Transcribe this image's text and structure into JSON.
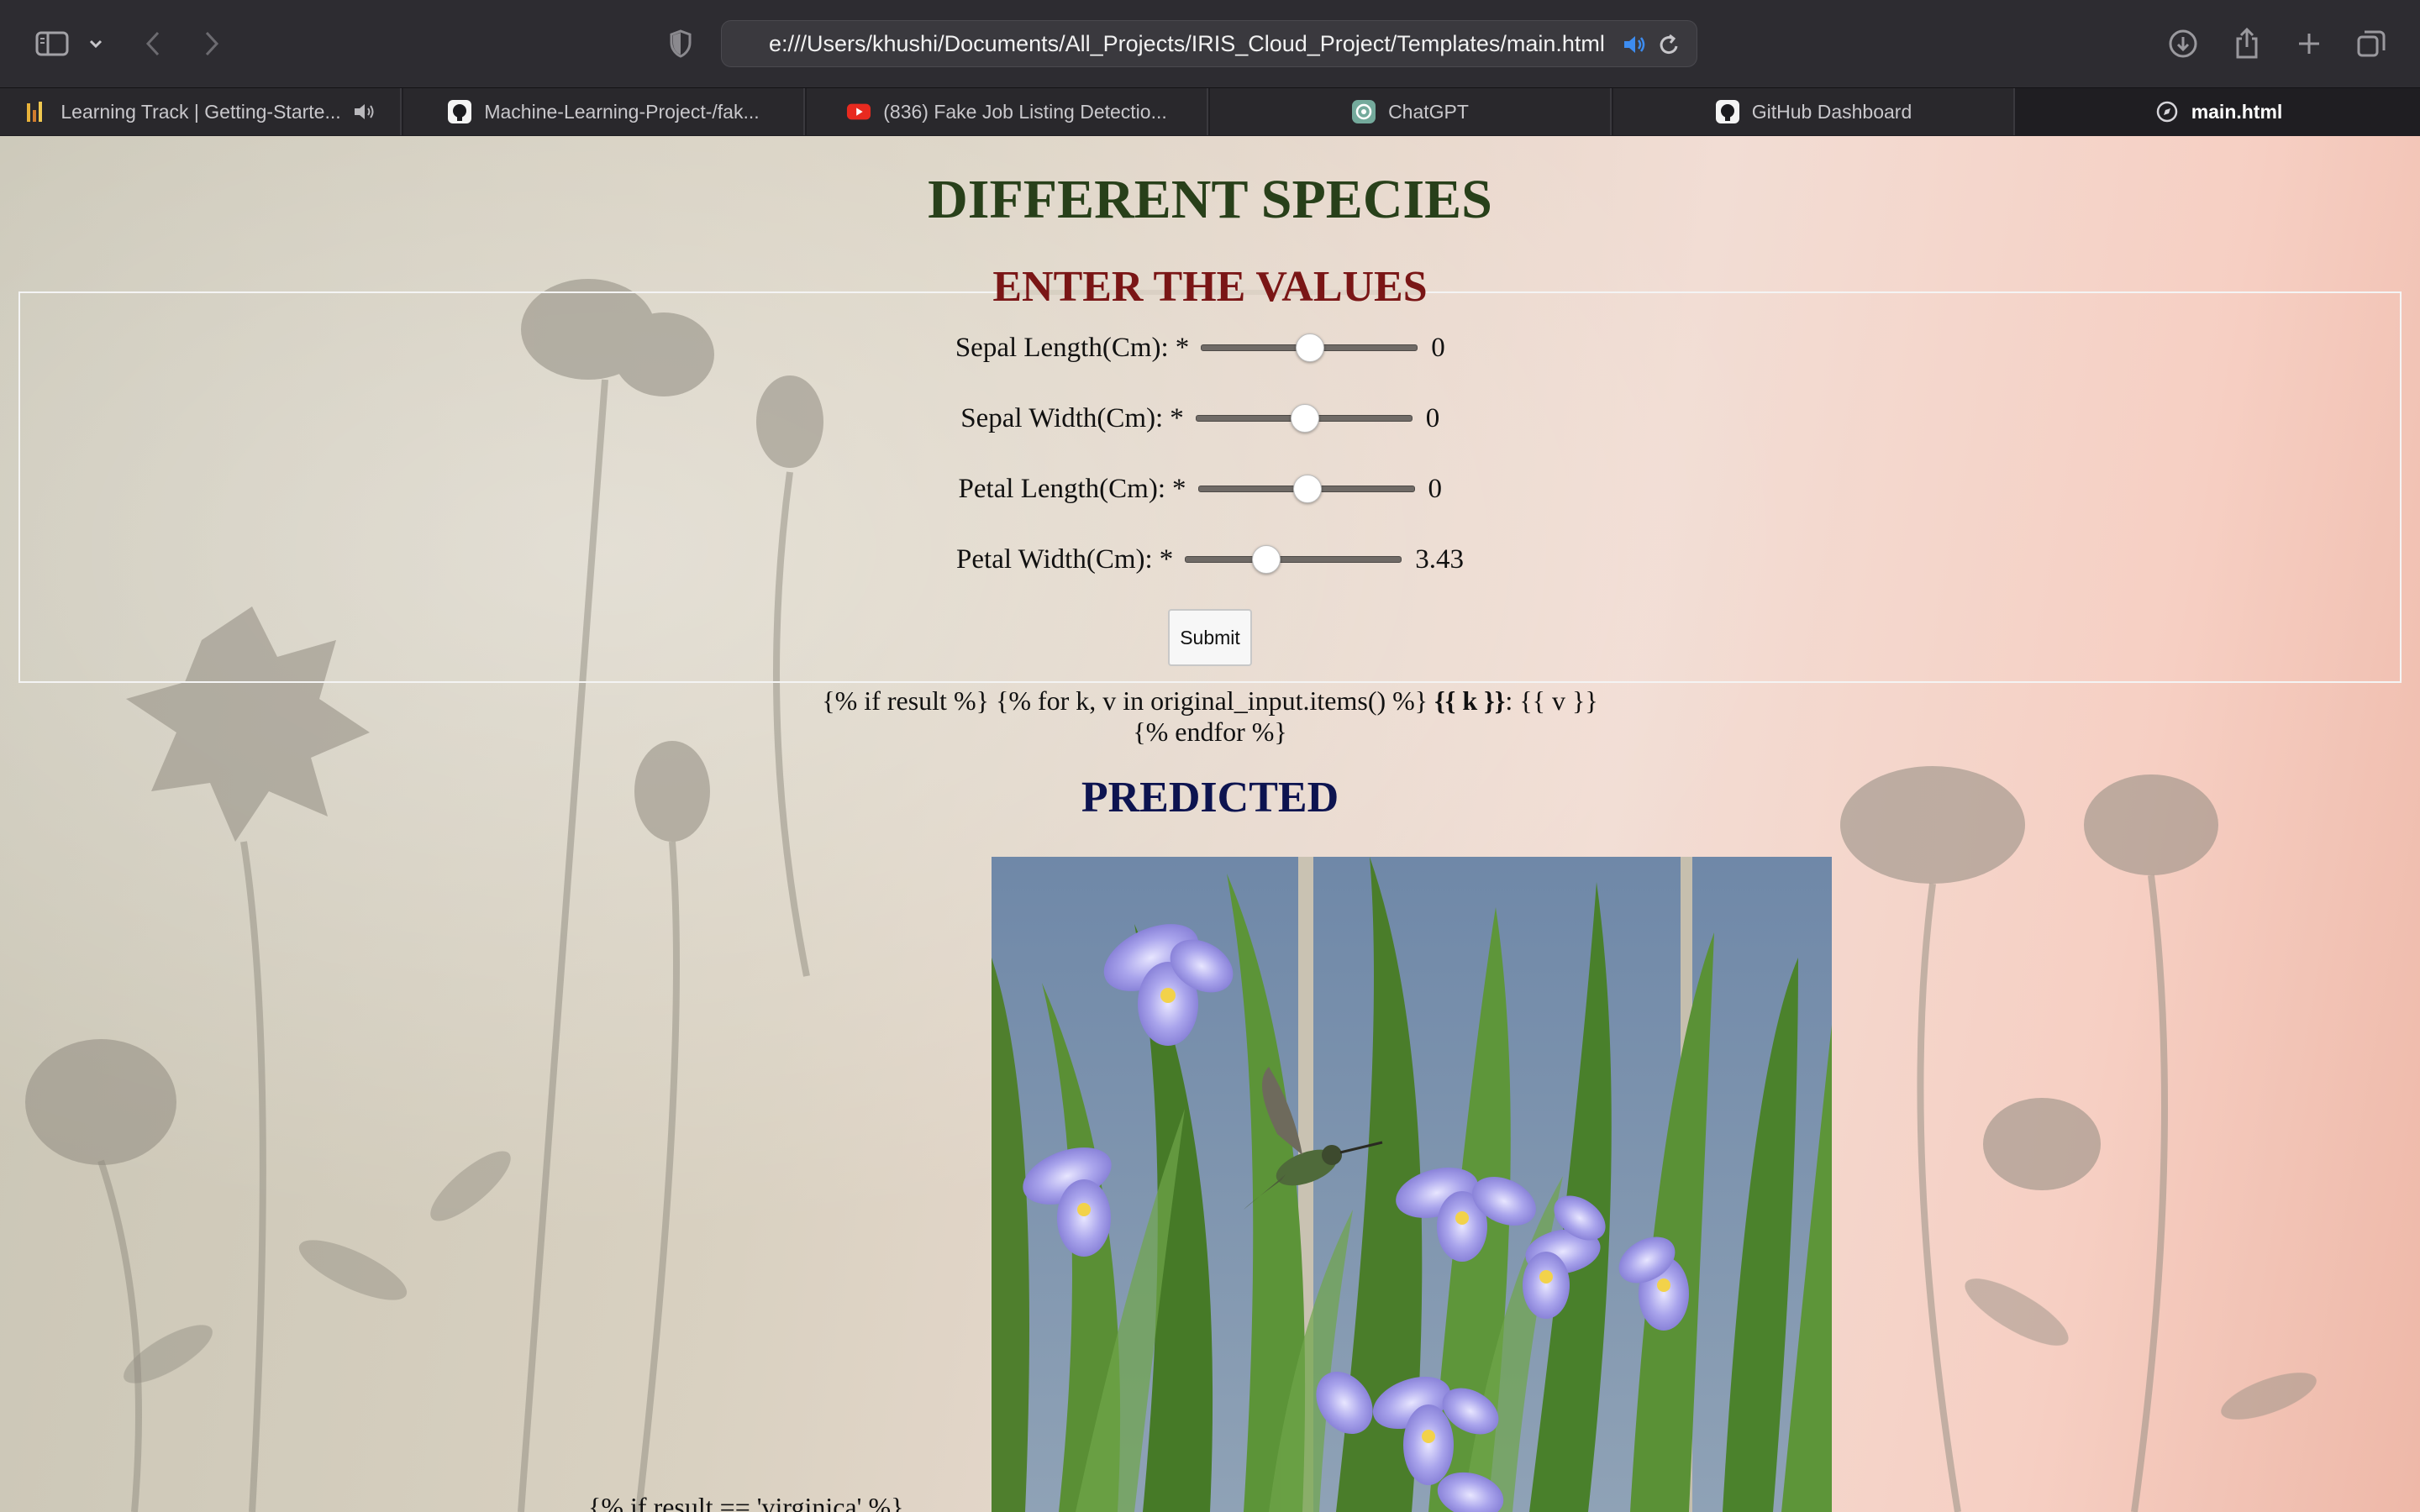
{
  "browser": {
    "url": "e:///Users/khushi/Documents/All_Projects/IRIS_Cloud_Project/Templates/main.html",
    "tabs": [
      {
        "label": "Learning Track | Getting-Starte...",
        "icon": "bar-chart-icon",
        "audio": true
      },
      {
        "label": "Machine-Learning-Project-/fak...",
        "icon": "github-icon"
      },
      {
        "label": "(836) Fake Job Listing Detectio...",
        "icon": "youtube-icon"
      },
      {
        "label": "ChatGPT",
        "icon": "chatgpt-icon"
      },
      {
        "label": "GitHub Dashboard",
        "icon": "github-icon"
      },
      {
        "label": "main.html",
        "icon": "compass-icon",
        "active": true
      }
    ]
  },
  "page": {
    "title": "DIFFERENT SPECIES",
    "form": {
      "legend": "ENTER THE VALUES",
      "required_mark": "*",
      "fields": [
        {
          "label": "Sepal Length(Cm):",
          "value": "0",
          "slider_fraction": 0.5
        },
        {
          "label": "Sepal Width(Cm):",
          "value": "0",
          "slider_fraction": 0.5
        },
        {
          "label": "Petal Length(Cm):",
          "value": "0",
          "slider_fraction": 0.5
        },
        {
          "label": "Petal Width(Cm):",
          "value": "3.43",
          "slider_fraction": 0.37
        }
      ],
      "submit_label": "Submit"
    },
    "template_line1_pre": "{% if result %} {% for k, v in original_input.items() %} ",
    "template_line1_bold": "{{ k }}",
    "template_line1_post": ": {{ v }}",
    "template_line2": "{% endfor %}",
    "predicted_heading": "PREDICTED",
    "bottom_snippet": "{% if result == 'virginica' %}"
  },
  "colors": {
    "title": "#28401a",
    "legend": "#7a1616",
    "predicted": "#0d1450"
  }
}
